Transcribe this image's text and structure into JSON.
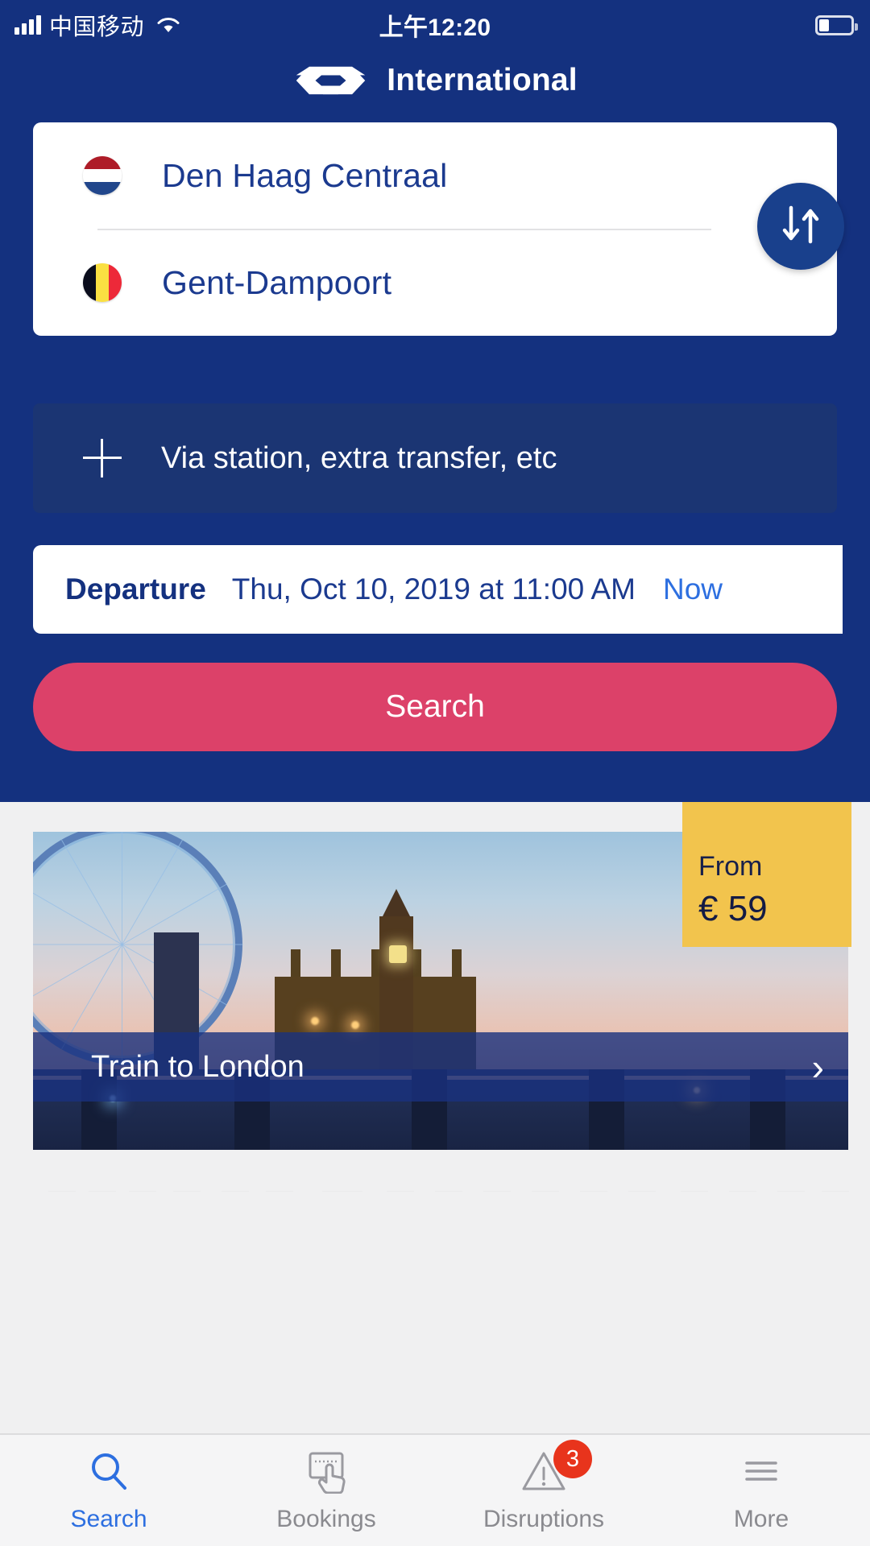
{
  "status_bar": {
    "carrier": "中国移动",
    "time": "上午12:20",
    "signal_icon": "signal-bars-icon",
    "wifi_icon": "wifi-icon",
    "battery_icon": "battery-icon"
  },
  "header": {
    "title": "International",
    "logo_icon": "ns-logo-icon"
  },
  "journey": {
    "origin": {
      "station": "Den Haag Centraal",
      "flag": "netherlands-flag"
    },
    "destination": {
      "station": "Gent-Dampoort",
      "flag": "belgium-flag"
    },
    "swap_icon": "swap-arrows-icon",
    "via": {
      "label": "Via station, extra transfer, etc",
      "icon": "plus-icon"
    },
    "departure": {
      "label": "Departure",
      "value": "Thu, Oct 10, 2019 at 11:00 AM",
      "now_link": "Now"
    },
    "search_button": "Search"
  },
  "promo": {
    "caption": "Train to London",
    "price_from_label": "From",
    "price_value": "€ 59",
    "chevron_icon": "chevron-right-icon"
  },
  "tab_bar": {
    "tabs": [
      {
        "label": "Search",
        "icon": "search-icon",
        "badge": ""
      },
      {
        "label": "Bookings",
        "icon": "bookings-icon",
        "badge": ""
      },
      {
        "label": "Disruptions",
        "icon": "warning-triangle-icon",
        "badge": "3"
      },
      {
        "label": "More",
        "icon": "hamburger-menu-icon",
        "badge": ""
      }
    ]
  },
  "colors": {
    "brand_navy": "#14317f",
    "accent_pink": "#dc4169",
    "link_blue": "#2d6fe0",
    "badge_yellow": "#f2c44d",
    "badge_red": "#e8341c"
  }
}
